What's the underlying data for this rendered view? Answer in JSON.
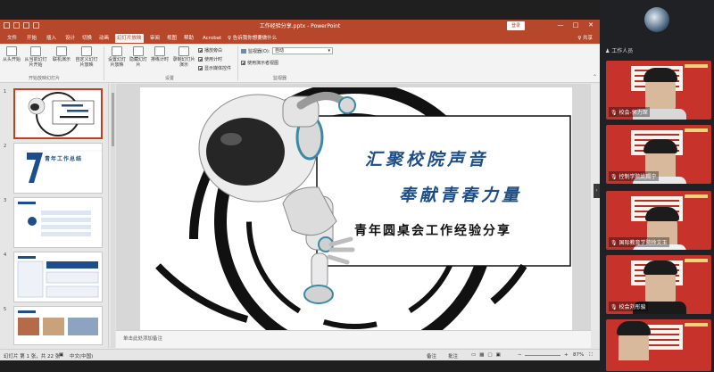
{
  "window": {
    "title": "工作经验分享.pptx - PowerPoint",
    "login_label": "登录",
    "minimize": "—",
    "maximize": "□",
    "close": "✕"
  },
  "tabs": [
    "文件",
    "开始",
    "插入",
    "设计",
    "切换",
    "动画",
    "幻灯片放映",
    "审阅",
    "视图",
    "帮助",
    "Acrobat"
  ],
  "active_tab": "幻灯片放映",
  "tell_me": "♀ 告诉我你想要做什么",
  "share_label": "♀ 共享",
  "ribbon": {
    "buttons": [
      {
        "label": "从头开始",
        "icon": "play-from-start-icon"
      },
      {
        "label": "从当前幻灯片开始",
        "icon": "play-from-current-icon"
      },
      {
        "label": "联机演示",
        "icon": "online-present-icon"
      },
      {
        "label": "自定义幻灯片放映",
        "icon": "custom-show-icon"
      },
      {
        "label": "设置幻灯片放映",
        "icon": "setup-show-icon"
      },
      {
        "label": "隐藏幻灯片",
        "icon": "hide-slide-icon"
      },
      {
        "label": "排练计时",
        "icon": "rehearse-icon"
      },
      {
        "label": "录制幻灯片演示",
        "icon": "record-icon"
      }
    ],
    "checkboxes": [
      {
        "label": "播放旁白",
        "checked": true
      },
      {
        "label": "使用计时",
        "checked": true
      },
      {
        "label": "显示媒体控件",
        "checked": true
      }
    ],
    "monitor_label": "监视器(O):",
    "monitor_value": "自动",
    "presenter_view_label": "使用演示者视图",
    "groups": [
      "开始放映幻灯片",
      "设置",
      "监视器"
    ]
  },
  "thumbnails": [
    "1",
    "2",
    "3",
    "4",
    "5"
  ],
  "slide": {
    "line1": "汇聚校院声音",
    "line2": "奉献青春力量",
    "line3": "青年圆桌会工作经验分享"
  },
  "thumb2_title": "青年工作总结",
  "notes_placeholder": "单击此处添加备注",
  "status": {
    "slide_count": "幻灯片 第 1 张，共 22 张",
    "language": "中文(中国)",
    "notes": "备注",
    "comments": "批注",
    "zoom": "87%"
  },
  "meeting": {
    "header": "工作人员",
    "participants": [
      {
        "name": "校会-郭力琛"
      },
      {
        "name": "控制学院姚赐宁"
      },
      {
        "name": "国际教育学院徐文玉"
      },
      {
        "name": "校会刘彤骏"
      }
    ]
  }
}
